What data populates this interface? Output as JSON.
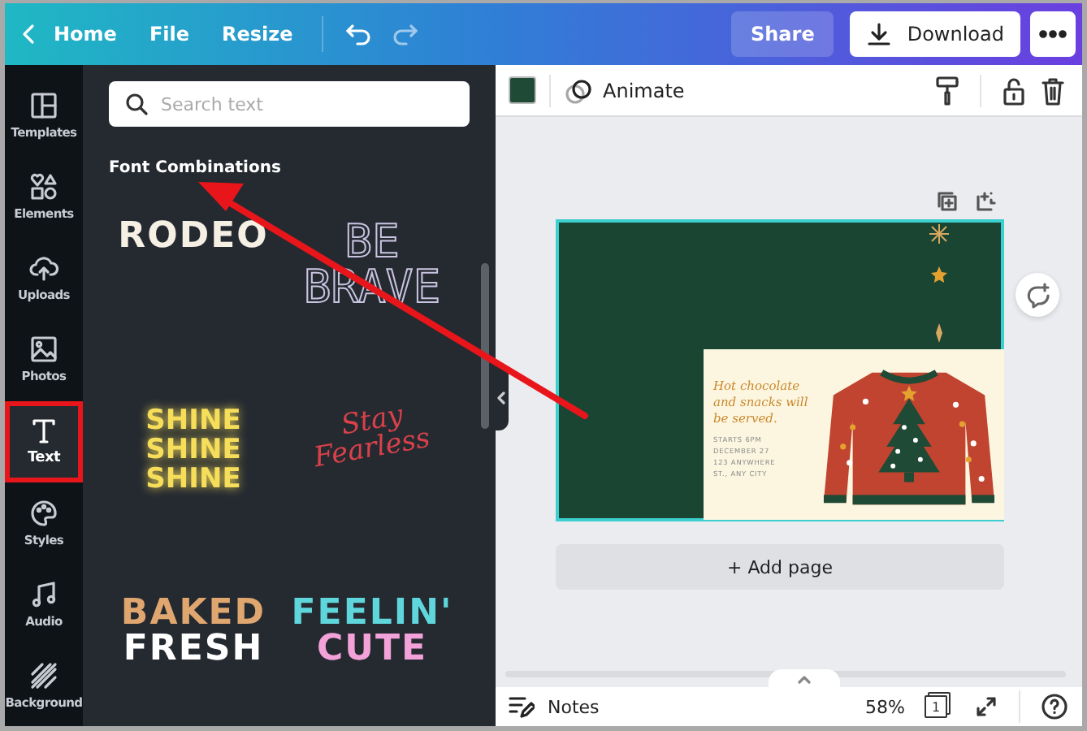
{
  "top_bar": {
    "home": "Home",
    "menu": [
      "File",
      "Resize"
    ],
    "share": "Share",
    "download": "Download"
  },
  "sidebar": {
    "items": [
      {
        "label": "Templates",
        "selected": false,
        "highlighted": false
      },
      {
        "label": "Elements",
        "selected": false,
        "highlighted": false
      },
      {
        "label": "Uploads",
        "selected": false,
        "highlighted": false
      },
      {
        "label": "Photos",
        "selected": false,
        "highlighted": false
      },
      {
        "label": "Text",
        "selected": true,
        "highlighted": true
      },
      {
        "label": "Styles",
        "selected": false,
        "highlighted": false
      },
      {
        "label": "Audio",
        "selected": false,
        "highlighted": false
      },
      {
        "label": "Background",
        "selected": false,
        "highlighted": false
      }
    ]
  },
  "panel": {
    "search": {
      "placeholder": "Search text"
    },
    "heading": "Font Combinations",
    "tiles": [
      {
        "kind": "solid",
        "lines": [
          {
            "text": "RODEO",
            "color": "#f5efe4"
          }
        ]
      },
      {
        "kind": "outline",
        "lines": [
          {
            "text": "BE"
          },
          {
            "text": "BRAVE"
          }
        ]
      },
      {
        "kind": "glow",
        "lines": [
          {
            "text": "SHINE",
            "color": "#f7de5a"
          },
          {
            "text": "SHINE",
            "color": "#f7de5a"
          },
          {
            "text": "SHINE",
            "color": "#f7de5a"
          }
        ]
      },
      {
        "kind": "script",
        "lines": [
          {
            "text": "Stay",
            "color": "#d9414a"
          },
          {
            "text": "Fearless",
            "color": "#d9414a"
          }
        ]
      },
      {
        "kind": "solid",
        "lines": [
          {
            "text": "BAKED",
            "color": "#e0a66f"
          },
          {
            "text": "FRESH",
            "color": "#ffffff"
          }
        ]
      },
      {
        "kind": "solid",
        "lines": [
          {
            "text": "FEELIN'",
            "color": "#5fd6dc"
          },
          {
            "text": "CUTE",
            "color": "#f2a2d8"
          }
        ]
      }
    ]
  },
  "editor_toolbar": {
    "color": "#1e4a36",
    "animate": "Animate"
  },
  "design": {
    "headline": "Hot chocolate and snacks will be served.",
    "details": [
      "STARTS 6PM",
      "DECEMBER 27",
      "123 ANYWHERE",
      "ST., ANY CITY"
    ]
  },
  "add_page": "+ Add page",
  "status_bar": {
    "notes": "Notes",
    "zoom": "58%",
    "page_count": "1"
  }
}
